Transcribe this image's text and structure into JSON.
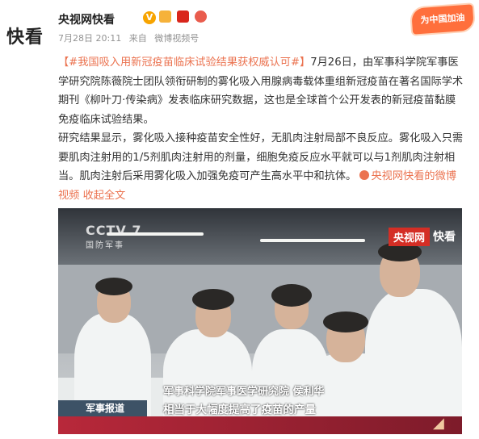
{
  "header": {
    "avatar_text": "快看",
    "account_name": "央视网快看",
    "verified_badge": "V",
    "icons": [
      "member-icon",
      "china-flag-icon",
      "medal-icon"
    ],
    "time": "7月28日 20:11",
    "source_prefix": "来自",
    "source": "微博视频号",
    "promo_badge": "为中国加油"
  },
  "post": {
    "hashtag": "【#我国吸入用新冠疫苗临床试验结果获权威认可#】",
    "para1_rest": "7月26日，由军事科学院军事医学研究院陈薇院士团队领衔研制的雾化吸入用腺病毒载体重组新冠疫苗在著名国际学术期刊《柳叶刀·传染病》发表临床研究数据，这也是全球首个公开发表的新冠疫苗黏膜免疫临床试验结果。",
    "para2": "研究结果显示，雾化吸入接种疫苗安全性好，无肌肉注射局部不良反应。雾化吸入只需要肌肉注射用的1/5剂肌肉注射用的剂量，细胞免疫反应水平就可以与1剂肌肉注射相当。肌肉注射后采用雾化吸入加强免疫可产生高水平中和抗体。",
    "source_link": "央视网快看的微博视频",
    "collapse": "收起全文"
  },
  "video": {
    "channel_logo": "CCTV 7",
    "channel_sub": "国防军事",
    "watermark_red": "央视网",
    "watermark_white": "快看",
    "caption_name": "军事科学院军事医学研究院  侯利华",
    "caption_tag": "军事报道",
    "caption_sub": "相当于大幅度提高了疫苗的产量"
  },
  "colors": {
    "link": "#eb7350",
    "badge": "#f7a400",
    "promo": "#ff6f3c"
  }
}
